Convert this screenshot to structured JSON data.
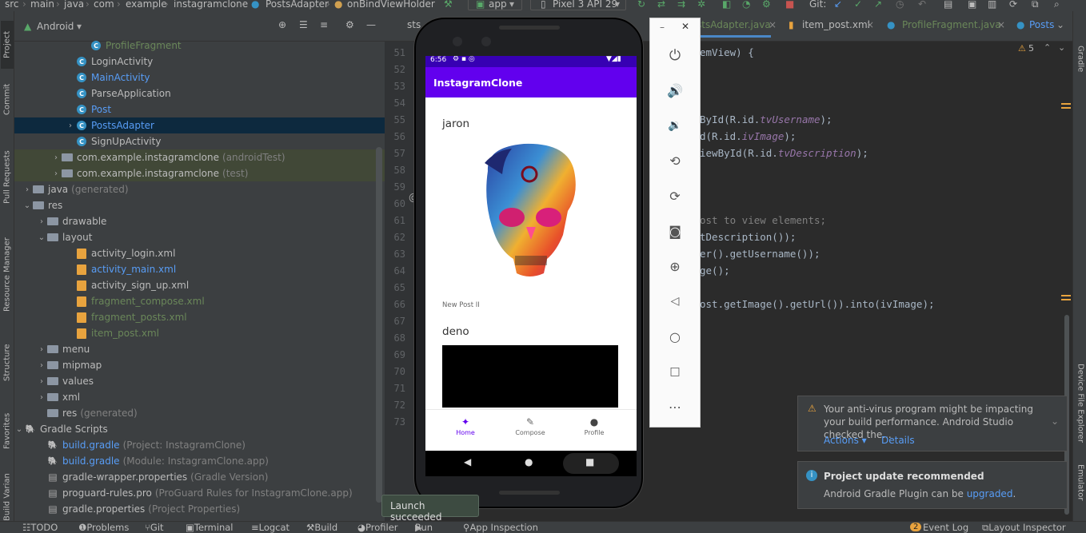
{
  "breadcrumb": [
    "src",
    "main",
    "java",
    "com",
    "example",
    "instagramclone",
    "PostsAdapter",
    "onBindViewHolder"
  ],
  "toolbar": {
    "config": "app",
    "device": "Pixel 3 API 29",
    "git": "Git:"
  },
  "left_tabs": [
    "Project",
    "Commit",
    "Pull Requests",
    "Resource Manager",
    "Structure",
    "Favorites",
    "Build Variants"
  ],
  "right_tabs": [
    "Gradle",
    "Device File Explorer",
    "Emulator"
  ],
  "project": {
    "view": "Android",
    "rows": [
      {
        "label": "ProfileFragment",
        "type": "class",
        "indent": 96,
        "color": "#6a8759"
      },
      {
        "label": "LoginActivity",
        "type": "class",
        "indent": 78,
        "color": "#bbbbbb"
      },
      {
        "label": "MainActivity",
        "type": "class",
        "indent": 78,
        "color": "#589df6"
      },
      {
        "label": "ParseApplication",
        "type": "class",
        "indent": 78,
        "color": "#bbbbbb"
      },
      {
        "label": "Post",
        "type": "class",
        "indent": 78,
        "color": "#589df6"
      },
      {
        "label": "PostsAdapter",
        "type": "class",
        "indent": 78,
        "color": "#589df6",
        "arrow": "›",
        "selected": true
      },
      {
        "label": "SignUpActivity",
        "type": "class",
        "indent": 78,
        "color": "#bbbbbb"
      },
      {
        "label": "com.example.instagramclone",
        "suffix": "(androidTest)",
        "type": "folder",
        "indent": 60,
        "arrow": "›",
        "hl": true
      },
      {
        "label": "com.example.instagramclone",
        "suffix": "(test)",
        "type": "folder",
        "indent": 60,
        "arrow": "›",
        "hl": true
      },
      {
        "label": "java",
        "suffix": "(generated)",
        "type": "folder",
        "indent": 24,
        "arrow": "›"
      },
      {
        "label": "res",
        "type": "folder",
        "indent": 24,
        "arrow": "⌄"
      },
      {
        "label": "drawable",
        "type": "folder",
        "indent": 42,
        "arrow": "›"
      },
      {
        "label": "layout",
        "type": "folder",
        "indent": 42,
        "arrow": "⌄"
      },
      {
        "label": "activity_login.xml",
        "type": "xml",
        "indent": 78,
        "color": "#bbbbbb"
      },
      {
        "label": "activity_main.xml",
        "type": "xml",
        "indent": 78,
        "color": "#589df6"
      },
      {
        "label": "activity_sign_up.xml",
        "type": "xml",
        "indent": 78,
        "color": "#bbbbbb"
      },
      {
        "label": "fragment_compose.xml",
        "type": "xml",
        "indent": 78,
        "color": "#6a8759"
      },
      {
        "label": "fragment_posts.xml",
        "type": "xml",
        "indent": 78,
        "color": "#6a8759"
      },
      {
        "label": "item_post.xml",
        "type": "xml",
        "indent": 78,
        "color": "#6a8759"
      },
      {
        "label": "menu",
        "type": "folder",
        "indent": 42,
        "arrow": "›"
      },
      {
        "label": "mipmap",
        "type": "folder",
        "indent": 42,
        "arrow": "›"
      },
      {
        "label": "values",
        "type": "folder",
        "indent": 42,
        "arrow": "›"
      },
      {
        "label": "xml",
        "type": "folder",
        "indent": 42,
        "arrow": "›"
      },
      {
        "label": "res",
        "suffix": "(generated)",
        "type": "folder",
        "indent": 42
      },
      {
        "label": "Gradle Scripts",
        "type": "gradle",
        "indent": 6,
        "arrow": "⌄"
      },
      {
        "label": "build.gradle",
        "suffix": "(Project: InstagramClone)",
        "type": "gradle",
        "indent": 42,
        "color": "#589df6"
      },
      {
        "label": "build.gradle",
        "suffix": "(Module: InstagramClone.app)",
        "type": "gradle",
        "indent": 42,
        "color": "#589df6"
      },
      {
        "label": "gradle-wrapper.properties",
        "suffix": "(Gradle Version)",
        "type": "prop",
        "indent": 42
      },
      {
        "label": "proguard-rules.pro",
        "suffix": "(ProGuard Rules for InstagramClone.app)",
        "type": "prop",
        "indent": 42
      },
      {
        "label": "gradle.properties",
        "suffix": "(Project Properties)",
        "type": "prop",
        "indent": 42
      }
    ]
  },
  "editor": {
    "tabs": [
      {
        "label": "sts",
        "color": "#bbbbbb"
      },
      {
        "label": "stsAdapter.java",
        "color": "#6a8759",
        "active": true
      },
      {
        "label": "item_post.xml",
        "color": "#bbbbbb"
      },
      {
        "label": "ProfileFragment.java",
        "color": "#6a8759"
      },
      {
        "label": "Posts",
        "color": "#589df6"
      }
    ],
    "warnings": "5",
    "line_numbers": [
      "51",
      "52",
      "53",
      "54",
      "55",
      "56",
      "57",
      "58",
      "59",
      "60",
      "61",
      "62",
      "63",
      "64",
      "65",
      "66",
      "67",
      "68",
      "69",
      "70",
      "71",
      "72",
      "73"
    ],
    "code": [
      {
        "line": 0,
        "text": "emView) {"
      },
      {
        "line": 4,
        "text": "ById(R.id.",
        "it": "tvUsername",
        "end": ");"
      },
      {
        "line": 5,
        "text": "d(R.id.",
        "it": "ivImage",
        "end": ");"
      },
      {
        "line": 6,
        "text": "iewById(R.id.",
        "it": "tvDescription",
        "end": ");"
      },
      {
        "line": 10,
        "text": "ost to view elements;",
        "comment": true
      },
      {
        "line": 11,
        "text": "tDescription());"
      },
      {
        "line": 12,
        "text": "er().getUsername());"
      },
      {
        "line": 13,
        "text": "ge();"
      },
      {
        "line": 15,
        "text": "ost.getImage().getUrl()).into(ivImage);"
      }
    ]
  },
  "phone": {
    "time": "6:56",
    "app_title": "InstagramClone",
    "posts": [
      {
        "username": "jaron",
        "description": "New Post II"
      },
      {
        "username": "deno"
      }
    ],
    "nav": [
      "Home",
      "Compose",
      "Profile"
    ]
  },
  "emulator_controls": [
    "power-icon",
    "volume-up-icon",
    "volume-down-icon",
    "rotate-left-icon",
    "rotate-right-icon",
    "camera-icon",
    "zoom-icon",
    "back-icon",
    "home-icon",
    "overview-icon",
    "more-icon"
  ],
  "toast": "Launch succeeded",
  "notifications": [
    {
      "title": "Your anti-virus program might be impacting your build performance. Android Studio checked the...",
      "actions": [
        "Actions ▾",
        "Details"
      ]
    },
    {
      "title": "Project update recommended",
      "body": "Android Gradle Plugin can be ",
      "link": "upgraded",
      "end": "."
    }
  ],
  "bottom": [
    "TODO",
    "Problems",
    "Git",
    "Terminal",
    "Logcat",
    "Build",
    "Profiler",
    "Run",
    "App Inspection"
  ],
  "bottom_right": {
    "event_log_count": "2",
    "event_log": "Event Log",
    "layout_inspector": "Layout Inspector"
  },
  "colors": {
    "accent": "#6200ee",
    "status": "#3700b3",
    "ide_bg": "#2b2b2b",
    "panel": "#3c3f41"
  }
}
